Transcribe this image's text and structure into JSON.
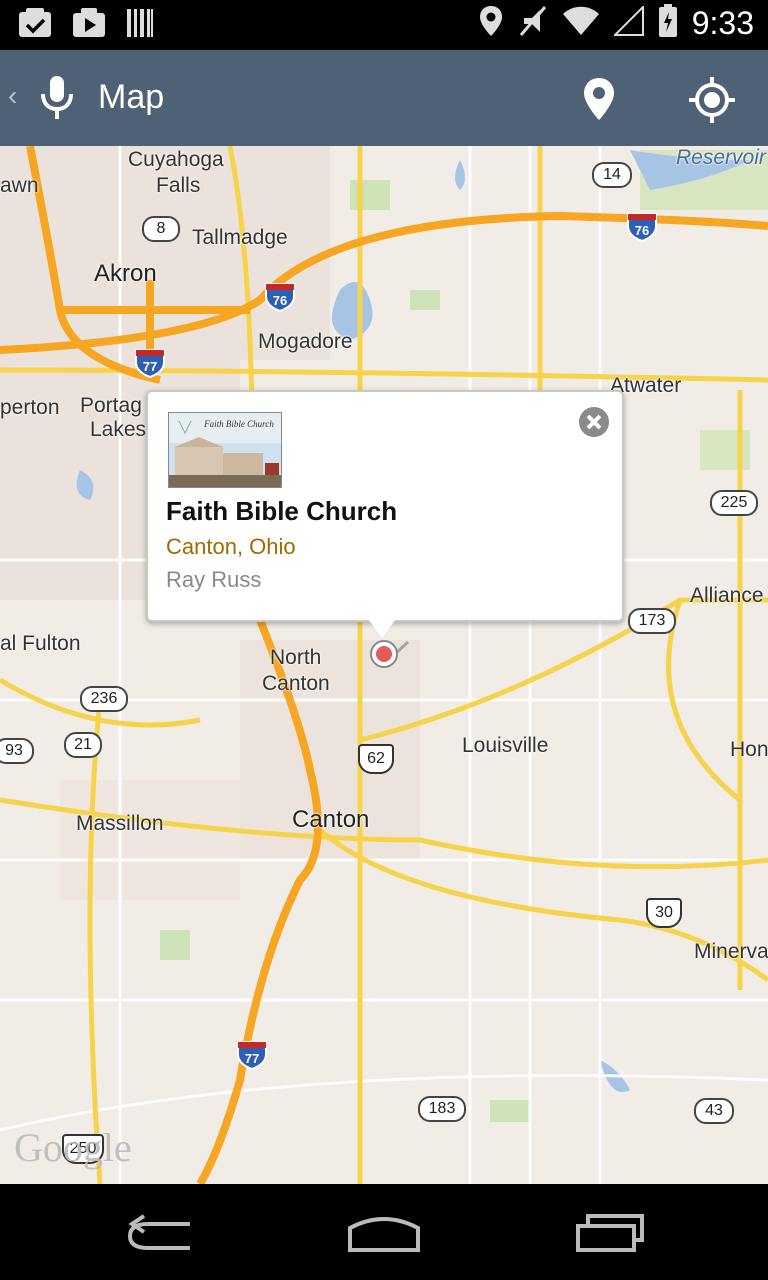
{
  "status_bar": {
    "time": "9:33",
    "icons": [
      "task-icon",
      "play-store-icon",
      "barcode-icon",
      "location-icon",
      "mute-icon",
      "wifi-icon",
      "battery-icon"
    ]
  },
  "action_bar": {
    "title": "Map",
    "icons": [
      "back-caret-icon",
      "microphone-icon",
      "map-pin-icon",
      "my-location-icon"
    ],
    "color": "#4f6275"
  },
  "map": {
    "labels": [
      "Cuyahoga",
      "Falls",
      "Tallmadge",
      "Akron",
      "Mogadore",
      "Reservoir",
      "Atwater",
      "perton",
      "Portag",
      "Lakes",
      "awn",
      "Alliance",
      "al Fulton",
      "North",
      "Canton",
      "Louisville",
      "Hon",
      "Massillon",
      "Canton",
      "Minerva"
    ],
    "shields": [
      "8",
      "14",
      "76",
      "76",
      "77",
      "225",
      "173",
      "236",
      "93",
      "21",
      "62",
      "30",
      "77",
      "183",
      "43",
      "250"
    ],
    "attribution": "Google"
  },
  "popup": {
    "title": "Faith Bible Church",
    "location": "Canton, Ohio",
    "author": "Ray Russ",
    "thumb_caption": "Faith Bible Church"
  },
  "nav_bar": {
    "icons": [
      "back-icon",
      "home-icon",
      "recents-icon"
    ]
  }
}
